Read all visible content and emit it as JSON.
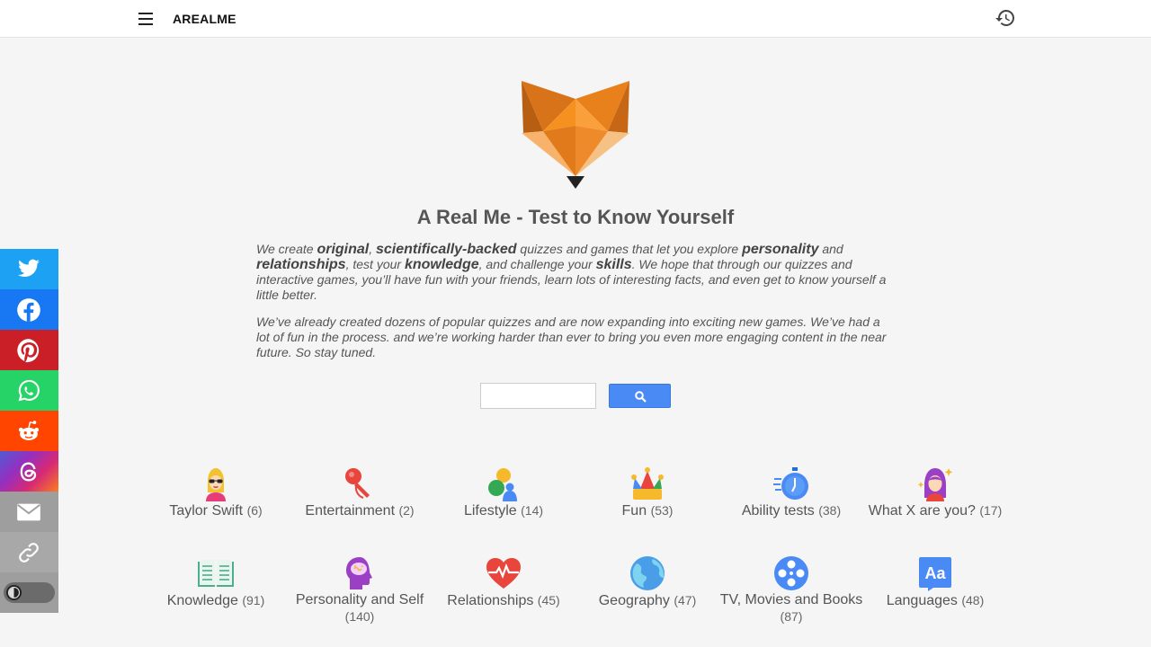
{
  "header": {
    "brand": "AREALME",
    "menu_icon": "hamburger-menu-icon",
    "history_icon": "history-icon"
  },
  "logo_icon": "fox-logo-icon",
  "hero": {
    "title": "A Real Me - Test to Know Yourself",
    "p1": {
      "t1": "We create ",
      "b1": "original",
      "t2": ", ",
      "b2": "scientifically-backed",
      "t3": " quizzes and games that let you explore ",
      "b3": "personality",
      "t4": " and ",
      "b4": "relationships",
      "t5": ", test your ",
      "b5": "knowledge",
      "t6": ", and challenge your ",
      "b6": "skills",
      "t7": ". We hope that through our quizzes and interactive games, you’ll have fun with your friends, learn lots of interesting facts, and even get to know yourself a little better."
    },
    "p2": "We’ve already created dozens of popular quizzes and are now expanding into exciting new games. We’ve had a lot of fun in the process. and we’re working harder than ever to bring you even more engaging content in the near future. So stay tuned."
  },
  "search": {
    "value": "",
    "placeholder": "",
    "button_icon": "search-icon"
  },
  "share_buttons": [
    {
      "icon": "twitter-icon",
      "color": "#1da1f2"
    },
    {
      "icon": "facebook-icon",
      "color": "#1877f2"
    },
    {
      "icon": "pinterest-icon",
      "color": "#cb1f27"
    },
    {
      "icon": "whatsapp-icon",
      "color": "#25d366"
    },
    {
      "icon": "reddit-icon",
      "color": "#ff4500"
    },
    {
      "icon": "threads-icon",
      "color": "#c13584"
    },
    {
      "icon": "email-icon",
      "color": "#9e9e9e"
    },
    {
      "icon": "link-icon",
      "color": "#9e9e9e"
    }
  ],
  "theme_toggle": {
    "icon": "dark-mode-toggle",
    "state": "off"
  },
  "categories": [
    {
      "label": "Taylor Swift",
      "count": "(6)",
      "icon": "taylor-swift-icon"
    },
    {
      "label": "Entertainment",
      "count": "(2)",
      "icon": "microphone-icon"
    },
    {
      "label": "Lifestyle",
      "count": "(14)",
      "icon": "lifestyle-shapes-icon"
    },
    {
      "label": "Fun",
      "count": "(53)",
      "icon": "jester-hat-icon"
    },
    {
      "label": "Ability tests",
      "count": "(38)",
      "icon": "stopwatch-icon"
    },
    {
      "label": "What X are you?",
      "count": "(17)",
      "icon": "princess-icon"
    },
    {
      "label": "Knowledge",
      "count": "(91)",
      "icon": "open-book-icon"
    },
    {
      "label": "Personality and Self",
      "count": "(140)",
      "icon": "head-brain-icon"
    },
    {
      "label": "Relationships",
      "count": "(45)",
      "icon": "heartbeat-icon"
    },
    {
      "label": "Geography",
      "count": "(47)",
      "icon": "globe-icon"
    },
    {
      "label": "TV, Movies and Books",
      "count": "(87)",
      "icon": "film-reel-icon"
    },
    {
      "label": "Languages",
      "count": "(48)",
      "icon": "language-aa-icon"
    }
  ]
}
